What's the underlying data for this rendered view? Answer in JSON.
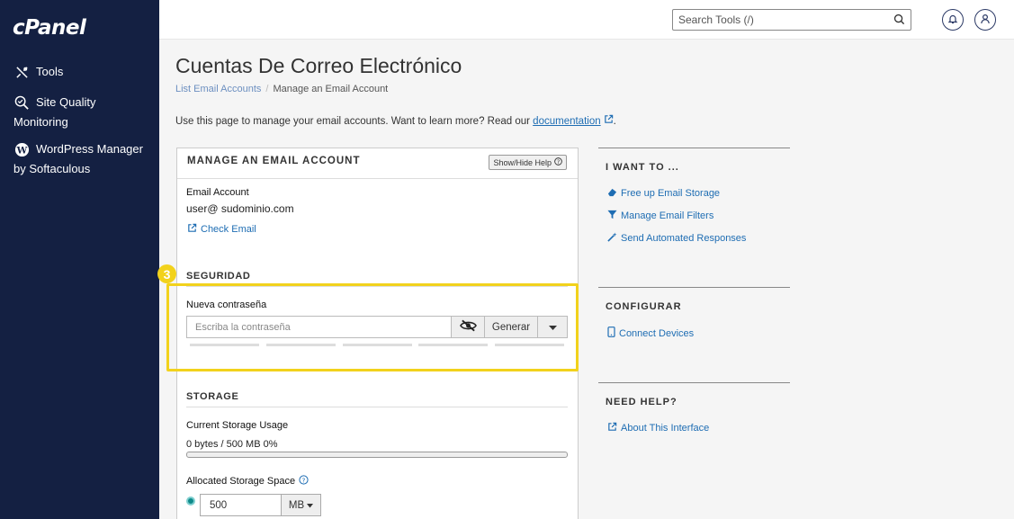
{
  "brand": {
    "logo_text": "cPanel"
  },
  "sidebar": {
    "items": [
      {
        "label": "Tools"
      },
      {
        "label_line1": "Site Quality",
        "label_line2": "Monitoring"
      },
      {
        "label_line1": "WordPress Manager",
        "label_line2": "by Softaculous"
      }
    ]
  },
  "header": {
    "search_placeholder": "Search Tools (/)"
  },
  "page": {
    "title": "Cuentas De Correo Electrónico",
    "breadcrumb": {
      "parent": "List Email Accounts",
      "separator": "/",
      "current": "Manage an Email Account"
    },
    "intro_text": "Use this page to manage your email accounts. Want to learn more? Read our ",
    "intro_link": "documentation",
    "intro_end": "."
  },
  "panel": {
    "title": "MANAGE AN EMAIL ACCOUNT",
    "help_button": "Show/Hide Help",
    "email_label": "Email Account",
    "email_value": "user@ sudominio.com",
    "check_email": "Check Email",
    "security": {
      "section_title": "SEGURIDAD",
      "badge": "3",
      "password_label": "Nueva contraseña",
      "password_placeholder": "Escriba la contraseña",
      "generate_button": "Generar"
    },
    "storage": {
      "section_title": "STORAGE",
      "usage_label": "Current Storage Usage",
      "usage_value": "0 bytes / 500 MB 0%",
      "usage_fraction": 0,
      "allocated_label": "Allocated Storage Space",
      "allocated_value": "500",
      "allocated_unit": "MB"
    }
  },
  "right": {
    "want_to": {
      "title": "I WANT TO ...",
      "links": [
        "Free up Email Storage",
        "Manage Email Filters",
        "Send Automated Responses"
      ]
    },
    "configure": {
      "title": "CONFIGURAR",
      "links": [
        "Connect Devices"
      ]
    },
    "need_help": {
      "title": "NEED HELP?",
      "links": [
        "About This Interface"
      ]
    }
  },
  "colors": {
    "sidebar": "#142042",
    "link": "#1e6db3",
    "highlight": "#f2d21c"
  }
}
